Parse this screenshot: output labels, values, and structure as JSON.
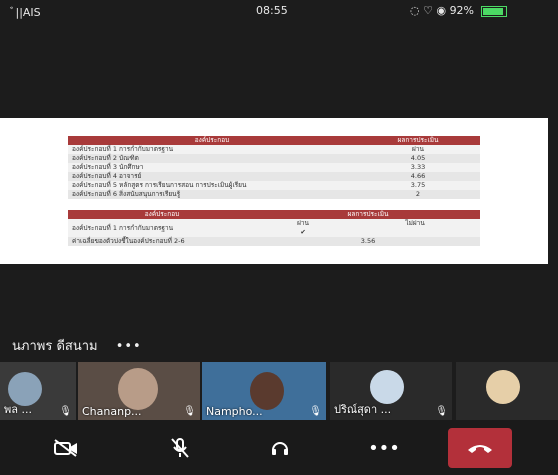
{
  "status": {
    "carrier": "ﾞ||AIS",
    "time": "08:55",
    "battery": "92%",
    "battery_fraction": 0.92
  },
  "shared": {
    "table1": {
      "headers": [
        "องค์ประกอบ",
        "ผลการประเมิน"
      ],
      "rows": [
        {
          "label": "องค์ประกอบที่ 1 การกำกับมาตรฐาน",
          "value": "ผ่าน"
        },
        {
          "label": "องค์ประกอบที่ 2 บัณฑิต",
          "value": "4.05"
        },
        {
          "label": "องค์ประกอบที่ 3 นักศึกษา",
          "value": "3.33"
        },
        {
          "label": "องค์ประกอบที่ 4 อาจารย์",
          "value": "4.66"
        },
        {
          "label": "องค์ประกอบที่ 5 หลักสูตร การเรียนการสอน การประเมินผู้เรียน",
          "value": "3.75"
        },
        {
          "label": "องค์ประกอบที่ 6 สิ่งสนับสนุนการเรียนรู้",
          "value": "2"
        }
      ]
    },
    "table2": {
      "headers": [
        "องค์ประกอบ",
        "ผลการประเมิน"
      ],
      "subheaders": [
        "ผ่าน",
        "ไม่ผ่าน"
      ],
      "row1": {
        "label": "องค์ประกอบที่ 1 การกำกับมาตรฐาน",
        "mark": "✔"
      },
      "row2": {
        "label": "ค่าเฉลี่ยของตัวบ่งชี้ในองค์ประกอบที่ 2-6",
        "value": "3.56"
      }
    }
  },
  "speaker": {
    "name": "นภาพร ดีสนาม",
    "more": "•••"
  },
  "participants": [
    {
      "label": "พล ..."
    },
    {
      "label": "Chananp..."
    },
    {
      "label": "Nampho..."
    },
    {
      "label": "ปริณ์สุดา ..."
    },
    {
      "label": ""
    }
  ],
  "controls": {
    "more": "•••"
  }
}
